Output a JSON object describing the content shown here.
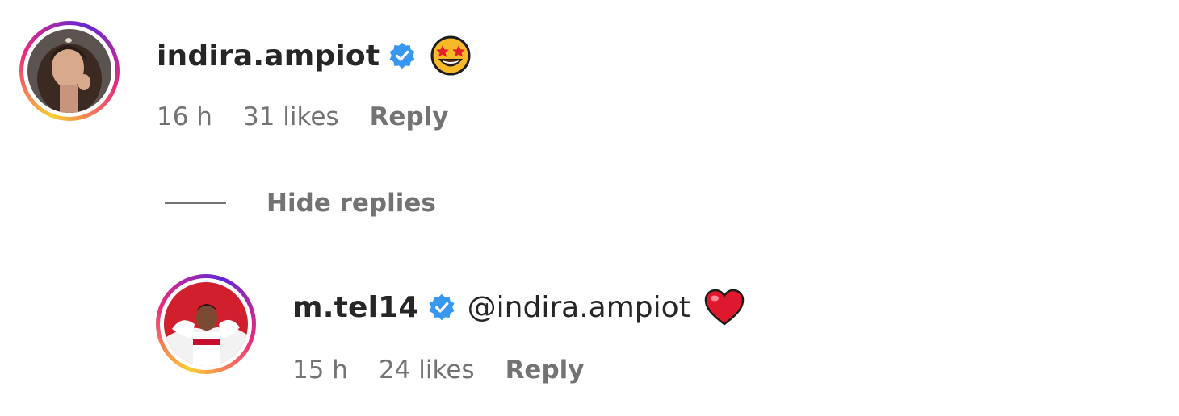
{
  "comments": [
    {
      "username": "indira.ampiot",
      "verified": true,
      "text_emoji": "star-struck-emoji",
      "time": "16 h",
      "likes": "31 likes",
      "reply_label": "Reply"
    }
  ],
  "replies_toggle": {
    "label": "Hide replies"
  },
  "replies": [
    {
      "username": "m.tel14",
      "verified": true,
      "mention": "@indira.ampiot",
      "text_emoji": "red-heart-emoji",
      "time": "15 h",
      "likes": "24 likes",
      "reply_label": "Reply"
    }
  ],
  "colors": {
    "verified_blue": "#3897f0",
    "meta_gray": "#737373",
    "text": "#262626",
    "heart_red": "#e0182d"
  }
}
